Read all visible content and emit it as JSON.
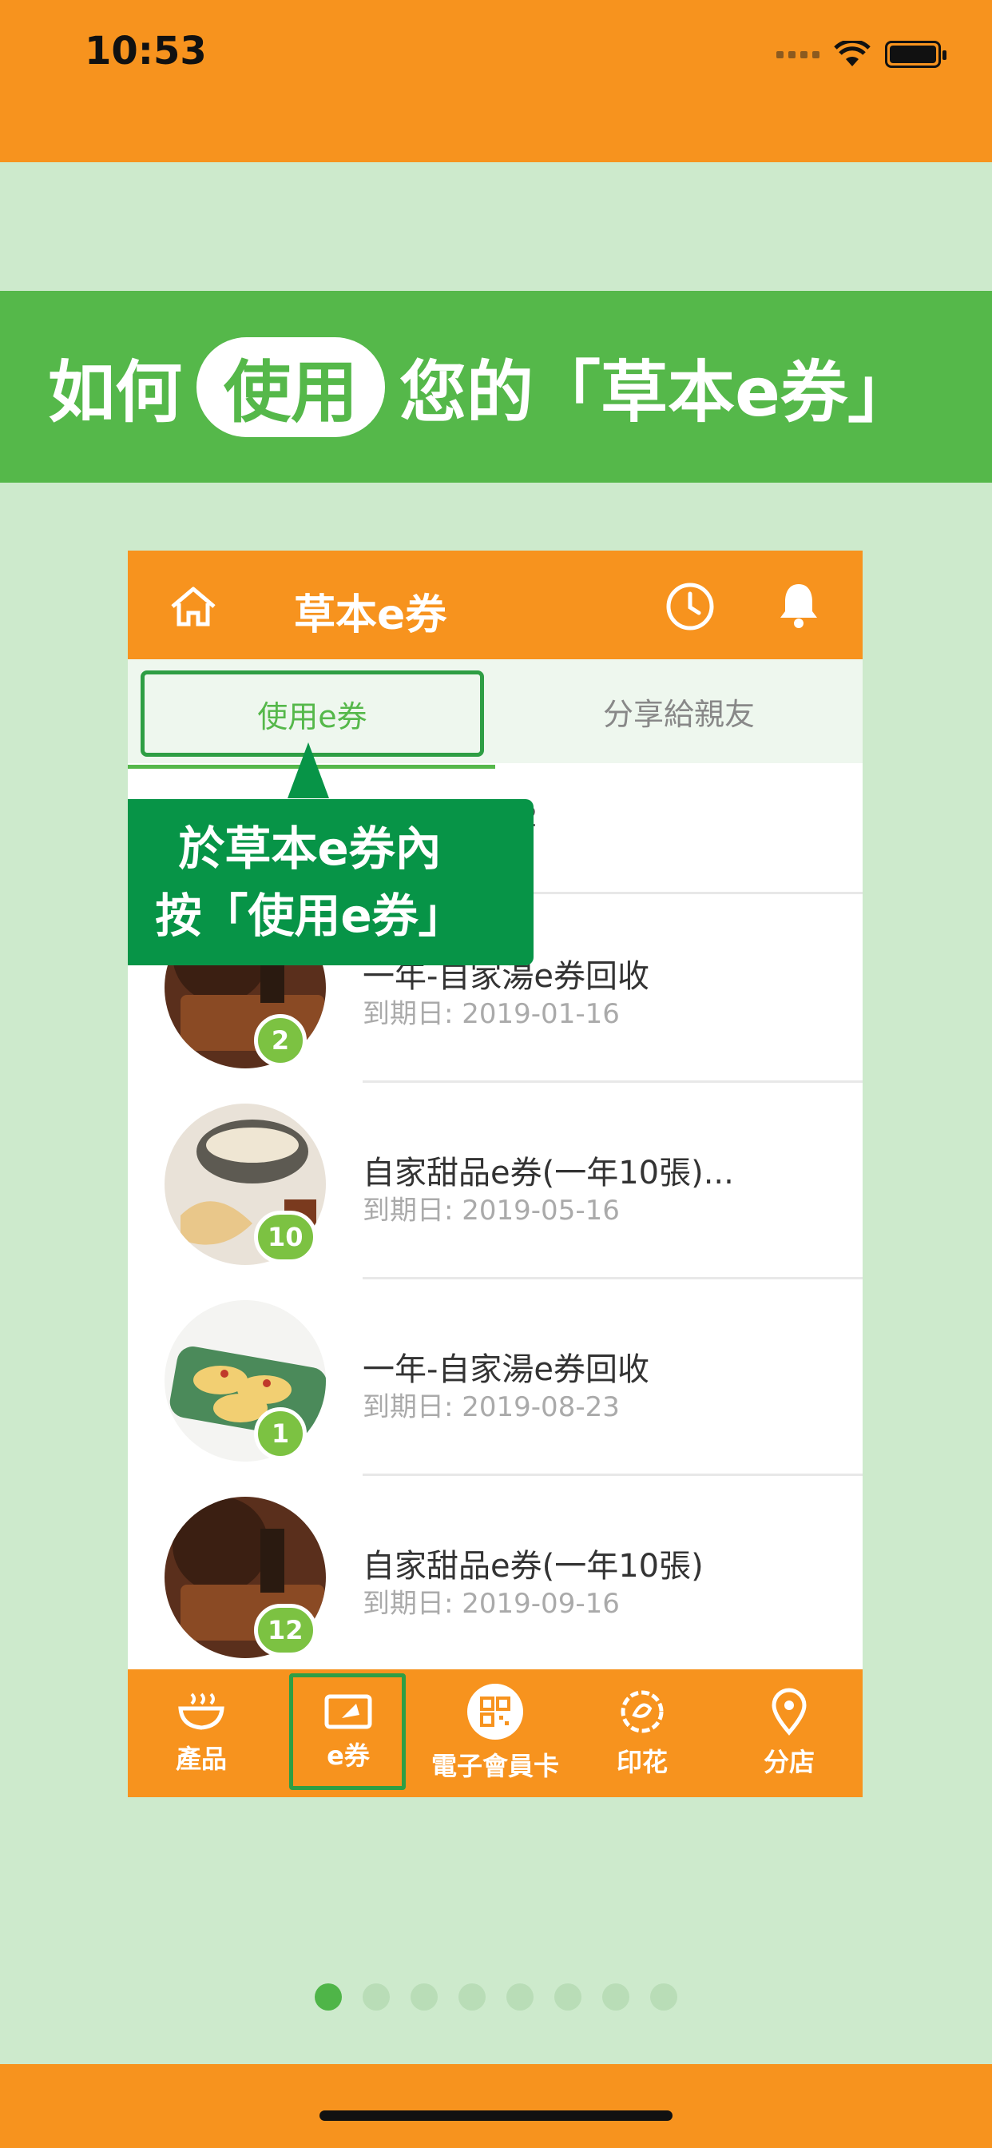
{
  "status": {
    "time": "10:53"
  },
  "banner": {
    "prefix": "如何",
    "highlight": "使用",
    "suffix": "您的「草本e券」"
  },
  "mock": {
    "title": "草本e券",
    "tabs": {
      "use": "使用e券",
      "share": "分享給親友"
    },
    "first_row_code": "02",
    "tooltip": {
      "line1": "於草本e券內",
      "line2": "按「使用e券」"
    },
    "items": [
      {
        "title": "一年-自家湯e券回收",
        "date": "到期日: 2019-01-16",
        "count": "2"
      },
      {
        "title": "自家甜品e券(一年10張)...",
        "date": "到期日: 2019-05-16",
        "count": "10"
      },
      {
        "title": "一年-自家湯e券回收",
        "date": "到期日: 2019-08-23",
        "count": "1"
      },
      {
        "title": "自家甜品e券(一年10張)",
        "date": "到期日: 2019-09-16",
        "count": "12"
      }
    ],
    "nav": [
      {
        "label": "產品",
        "icon": "bowl-icon"
      },
      {
        "label": "e券",
        "icon": "ticket-icon"
      },
      {
        "label": "電子會員卡",
        "icon": "qr-icon"
      },
      {
        "label": "印花",
        "icon": "flower-icon"
      },
      {
        "label": "分店",
        "icon": "location-pin-icon"
      }
    ]
  },
  "pager": {
    "count": 8,
    "active_index": 0
  },
  "colors": {
    "orange": "#f7931e",
    "green": "#55b84a",
    "dark_green": "#079447",
    "bg": "#cdeacc"
  }
}
